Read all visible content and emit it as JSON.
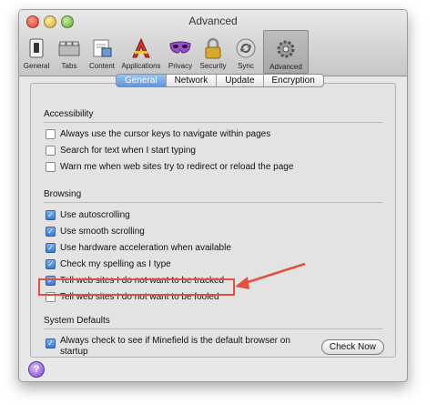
{
  "window": {
    "title": "Advanced",
    "toolbar": [
      {
        "label": "General",
        "icon": "switch-icon"
      },
      {
        "label": "Tabs",
        "icon": "tabs-icon"
      },
      {
        "label": "Content",
        "icon": "content-icon"
      },
      {
        "label": "Applications",
        "icon": "applications-icon"
      },
      {
        "label": "Privacy",
        "icon": "privacy-mask-icon"
      },
      {
        "label": "Security",
        "icon": "lock-icon"
      },
      {
        "label": "Sync",
        "icon": "sync-icon"
      },
      {
        "label": "Advanced",
        "icon": "gear-icon",
        "selected": true
      }
    ],
    "tabs": [
      {
        "label": "General",
        "active": true
      },
      {
        "label": "Network"
      },
      {
        "label": "Update"
      },
      {
        "label": "Encryption"
      }
    ],
    "accessibility": {
      "title": "Accessibility",
      "options": [
        {
          "label": "Always use the cursor keys to navigate within pages",
          "checked": false
        },
        {
          "label": "Search for text when I start typing",
          "checked": false
        },
        {
          "label": "Warn me when web sites try to redirect or reload the page",
          "checked": false
        }
      ]
    },
    "browsing": {
      "title": "Browsing",
      "options": [
        {
          "label": "Use autoscrolling",
          "checked": true
        },
        {
          "label": "Use smooth scrolling",
          "checked": true
        },
        {
          "label": "Use hardware acceleration when available",
          "checked": true
        },
        {
          "label": "Check my spelling as I type",
          "checked": true
        },
        {
          "label": "Tell web sites I do not want to be tracked",
          "checked": true
        },
        {
          "label": "Tell web sites I do not want to be fooled",
          "checked": false
        }
      ]
    },
    "system_defaults": {
      "title": "System Defaults",
      "default_browser_label": "Always check to see if Minefield is the default browser on startup",
      "default_browser_checked": true,
      "check_now_label": "Check Now"
    },
    "help_label": "?",
    "colors": {
      "accent_blue": "#5f96df",
      "annotation_red": "#e2513d"
    }
  }
}
